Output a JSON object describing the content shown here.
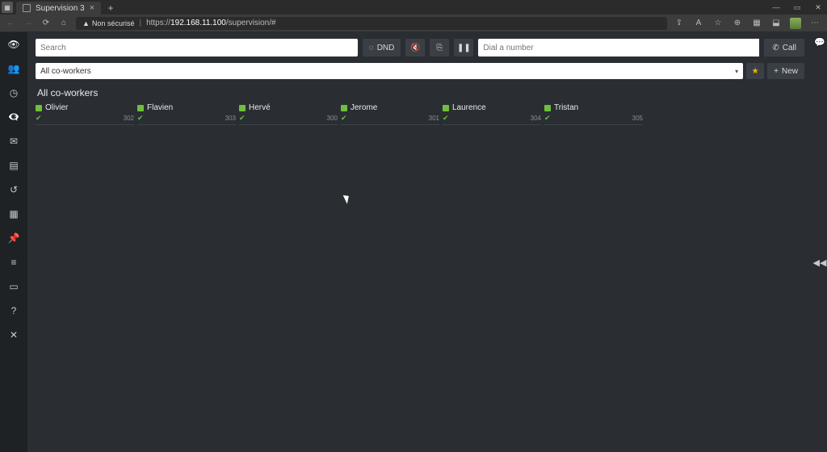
{
  "browser": {
    "tab_title": "Supervision 3",
    "security_label": "Non sécurisé",
    "url_scheme": "https",
    "url_host": "192.168.11.100",
    "url_path": "/supervision/#"
  },
  "toolbar": {
    "search_placeholder": "Search",
    "dnd_label": "DND",
    "dial_placeholder": "Dial a number",
    "call_label": "Call"
  },
  "filter": {
    "selected": "All co-workers",
    "new_label": "New"
  },
  "section": {
    "title": "All co-workers"
  },
  "coworkers": [
    {
      "name": "Olivier",
      "ext": "302"
    },
    {
      "name": "Flavien",
      "ext": "303"
    },
    {
      "name": "Hervé",
      "ext": "300"
    },
    {
      "name": "Jerome",
      "ext": "301"
    },
    {
      "name": "Laurence",
      "ext": "304"
    },
    {
      "name": "Tristan",
      "ext": "305"
    }
  ]
}
